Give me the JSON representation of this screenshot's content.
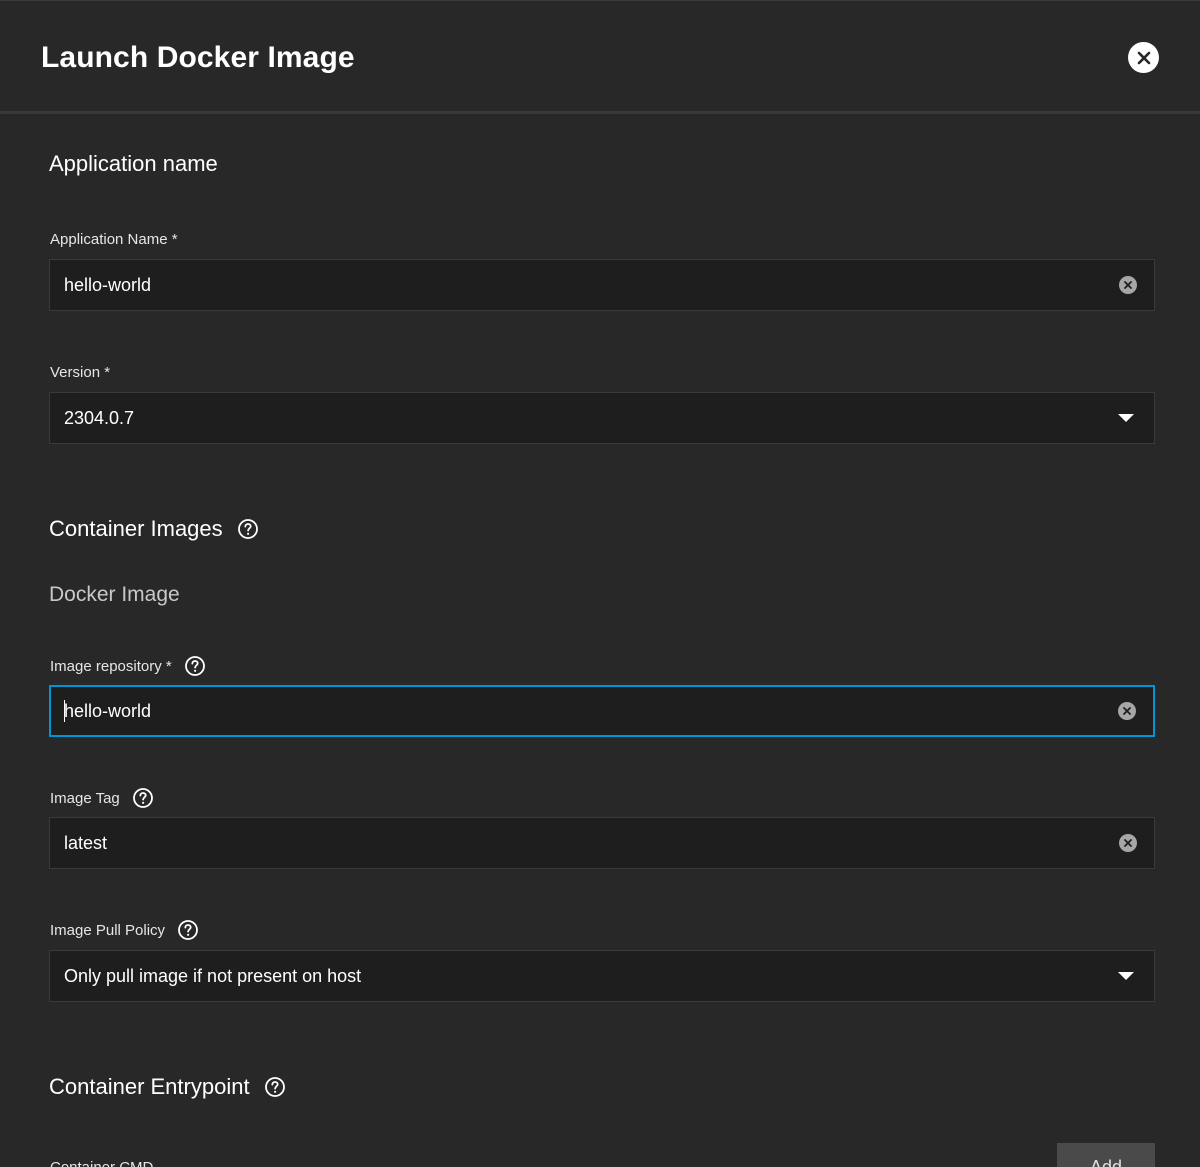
{
  "dialog": {
    "title": "Launch Docker Image",
    "close_icon": "close-circle-icon"
  },
  "sections": {
    "application_name": {
      "title": "Application name",
      "fields": {
        "app_name": {
          "label": "Application Name *",
          "value": "hello-world"
        },
        "version": {
          "label": "Version *",
          "value": "2304.0.7"
        }
      }
    },
    "container_images": {
      "title": "Container Images",
      "subsection": "Docker Image",
      "fields": {
        "image_repository": {
          "label": "Image repository *",
          "value": "hello-world"
        },
        "image_tag": {
          "label": "Image Tag",
          "value": "latest"
        },
        "image_pull_policy": {
          "label": "Image Pull Policy",
          "value": "Only pull image if not present on host"
        }
      }
    },
    "container_entrypoint": {
      "title": "Container Entrypoint",
      "cmd_label": "Container CMD",
      "add_label": "Add"
    }
  },
  "colors": {
    "background": "#282828",
    "field_bg": "#1e1e1e",
    "focus_border": "#0095d5",
    "text": "#ffffff"
  }
}
